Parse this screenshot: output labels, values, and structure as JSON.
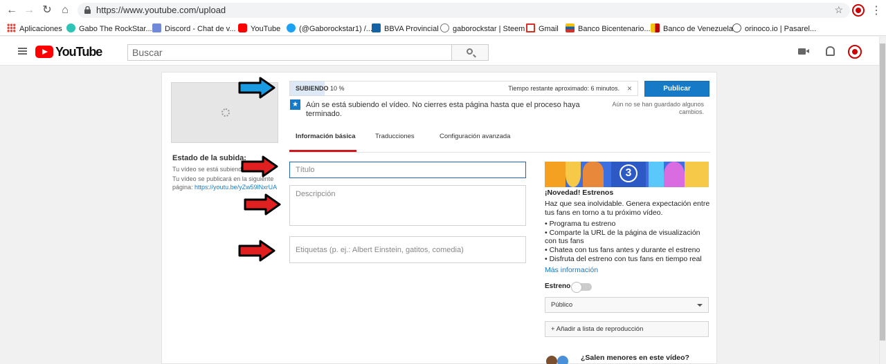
{
  "browser": {
    "url": "https://www.youtube.com/upload",
    "bookmarks": [
      {
        "label": "Aplicaciones",
        "color": "#ea4335"
      },
      {
        "label": "Gabo The RockStar...",
        "color": "#2ec4b6"
      },
      {
        "label": "Discord - Chat de v...",
        "color": "#7289da"
      },
      {
        "label": "YouTube",
        "color": "#ff0000"
      },
      {
        "label": "(@Gaborockstar1) /...",
        "color": "#1da1f2"
      },
      {
        "label": "BBVA Provincial",
        "color": "#1464a5"
      },
      {
        "label": "gaborockstar | Steem",
        "color": "#777777"
      },
      {
        "label": "Gmail",
        "color": "#d93025"
      },
      {
        "label": "Banco Bicentenario...",
        "color": "#f4c20d"
      },
      {
        "label": "Banco de Venezuela",
        "color": "#c00000"
      },
      {
        "label": "orinoco.io | Pasarel...",
        "color": "#555555"
      }
    ]
  },
  "header": {
    "logo_text": "YouTube",
    "search_placeholder": "Buscar"
  },
  "upload": {
    "status_title": "Estado de la subida:",
    "status_uploading": "Tu vídeo se está subiendo",
    "status_publish_prefix": "Tu vídeo se publicará en la siguiente página:",
    "status_link": "https://youtu.be/yZw59lNxrUA",
    "progress_label_bold": "SUBIENDO",
    "progress_label_value": "10 %",
    "progress_fraction": 0.1,
    "time_left": "Tiempo restante aproximado: 6 minutos.",
    "close_label": "×",
    "notice": "Aún se está subiendo el vídeo. No cierres esta página hasta que el proceso haya terminado.",
    "publish_label": "Publicar",
    "unsaved": "Aún no se han guardado algunos cambios."
  },
  "tabs": [
    {
      "label": "Información básica",
      "active": true
    },
    {
      "label": "Traducciones",
      "active": false
    },
    {
      "label": "Configuración avanzada",
      "active": false
    }
  ],
  "form": {
    "title_placeholder": "Título",
    "description_placeholder": "Descripción",
    "tags_placeholder": "Etiquetas (p. ej.: Albert Einstein, gatitos, comedia)"
  },
  "promo": {
    "badge_number": "3",
    "title": "¡Novedad! Estrenos",
    "description": "Haz que sea inolvidable. Genera expectación entre tus fans en torno a tu próximo vídeo.",
    "items": [
      "• Programa tu estreno",
      "• Comparte la URL de la página de visualización con tus fans",
      "• Chatea con tus fans antes y durante el estreno",
      "• Disfruta del estreno con tus fans en tiempo real"
    ],
    "more_link": "Más información"
  },
  "settings": {
    "premiere_label": "Estreno",
    "premiere_on": false,
    "privacy_value": "Público",
    "playlist_label": "+ Añadir a lista de reproducción",
    "kids_title": "¿Salen menores en este vídeo?"
  },
  "colors": {
    "accent_blue": "#167ac6",
    "yt_red": "#ff0000",
    "tab_red": "#cc181e",
    "arrow_blue": "#1a9ae0",
    "arrow_red": "#e02020"
  }
}
